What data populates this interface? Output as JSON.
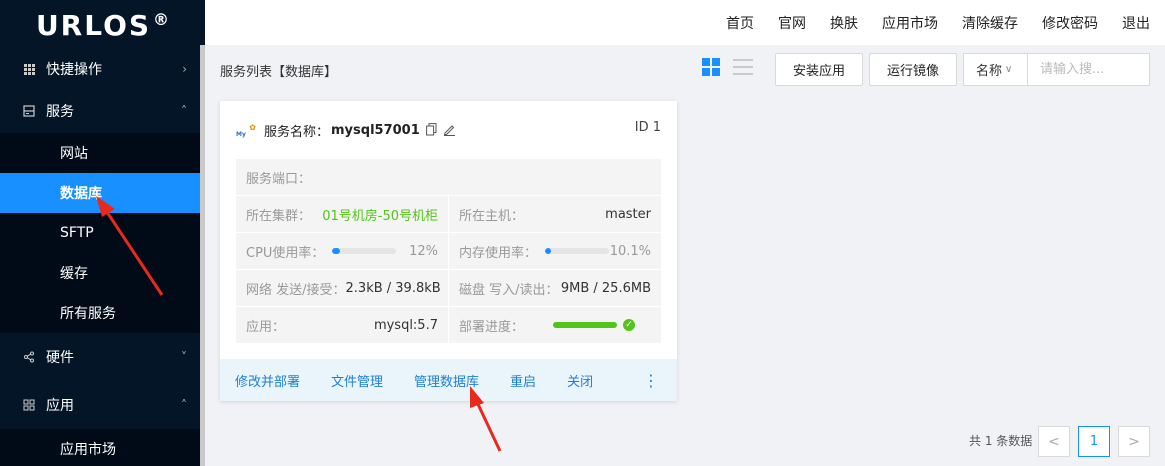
{
  "logo": {
    "text": "URLOS",
    "mark": "®"
  },
  "topnav": [
    "首页",
    "官网",
    "换肤",
    "应用市场",
    "清除缓存",
    "修改密码",
    "退出"
  ],
  "sidebar": {
    "quick": "快捷操作",
    "service": "服务",
    "service_items": [
      "网站",
      "数据库",
      "SFTP",
      "缓存",
      "所有服务"
    ],
    "active_item": "数据库",
    "hardware": "硬件",
    "app": "应用",
    "app_items": [
      "应用市场"
    ]
  },
  "content": {
    "breadcrumb": "服务列表【数据库】",
    "install_button": "安装应用",
    "mirror_button": "运行镜像",
    "filter_select": "名称",
    "search_placeholder": "请输入搜..."
  },
  "card": {
    "name_label": "服务名称：",
    "name": "mysql57001",
    "id": "ID 1",
    "port_label": "服务端口：",
    "cluster_label": "所在集群：",
    "cluster_value": "01号机房-50号机柜",
    "host_label": "所在主机：",
    "host_value": "master",
    "cpu_label": "CPU使用率：",
    "cpu_value": "12%",
    "cpu_fraction": 0.12,
    "mem_label": "内存使用率：",
    "mem_value": "10.1%",
    "mem_fraction": 0.101,
    "net_label": "网络 发送/接受：",
    "net_value": "2.3kB / 39.8kB",
    "disk_label": "磁盘 写入/读出：",
    "disk_value": "9MB / 25.6MB",
    "app_label": "应用：",
    "app_value": "mysql:5.7",
    "deploy_label": "部署进度：",
    "deploy_fraction": 1.0,
    "actions": [
      "修改并部署",
      "文件管理",
      "管理数据库",
      "重启",
      "关闭"
    ],
    "more": "⋮"
  },
  "pagination": {
    "total": "共 1 条数据",
    "current": "1",
    "prev": "<",
    "next": ">"
  },
  "colors": {
    "sidebar": "#041527",
    "active": "#1890ff",
    "link": "#1e7fd6",
    "success": "#52c41a",
    "arrow": "#e8291c"
  }
}
